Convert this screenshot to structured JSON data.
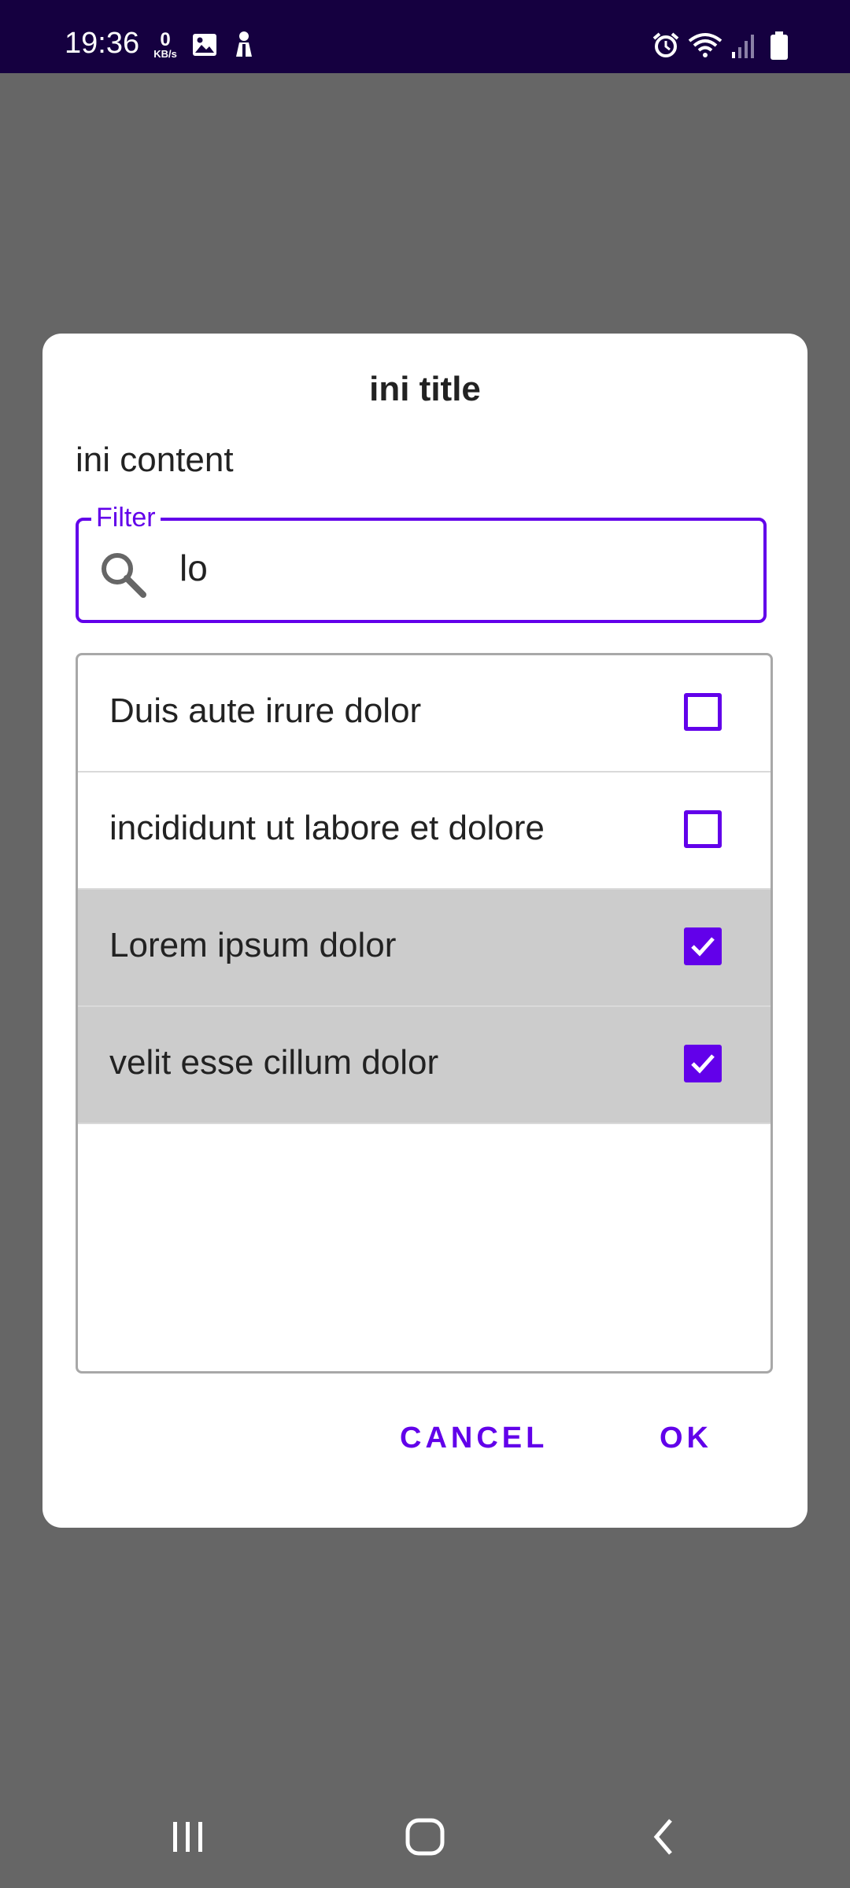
{
  "status_bar": {
    "time": "19:36",
    "net_speed_value": "0",
    "net_speed_unit": "KB/s",
    "left_icons": [
      "image-icon",
      "person-icon"
    ],
    "right_icons": [
      "alarm-icon",
      "wifi-icon",
      "signal-icon",
      "battery-icon"
    ]
  },
  "dialog": {
    "title": "ini title",
    "content": "ini content",
    "filter": {
      "label": "Filter",
      "value": "lo"
    },
    "items": [
      {
        "label": "Duis aute irure dolor",
        "checked": false
      },
      {
        "label": "incididunt ut labore et dolore",
        "checked": false
      },
      {
        "label": "Lorem ipsum dolor",
        "checked": true
      },
      {
        "label": "velit esse cillum dolor",
        "checked": true
      }
    ],
    "buttons": {
      "cancel": "CANCEL",
      "ok": "OK"
    }
  },
  "nav_bar": {
    "icons": [
      "recent-apps-icon",
      "home-icon",
      "back-icon"
    ]
  },
  "colors": {
    "accent": "#6200ea",
    "status_bar_bg": "#150040",
    "scrim": "#666666",
    "selected_row_bg": "#cccccc"
  }
}
